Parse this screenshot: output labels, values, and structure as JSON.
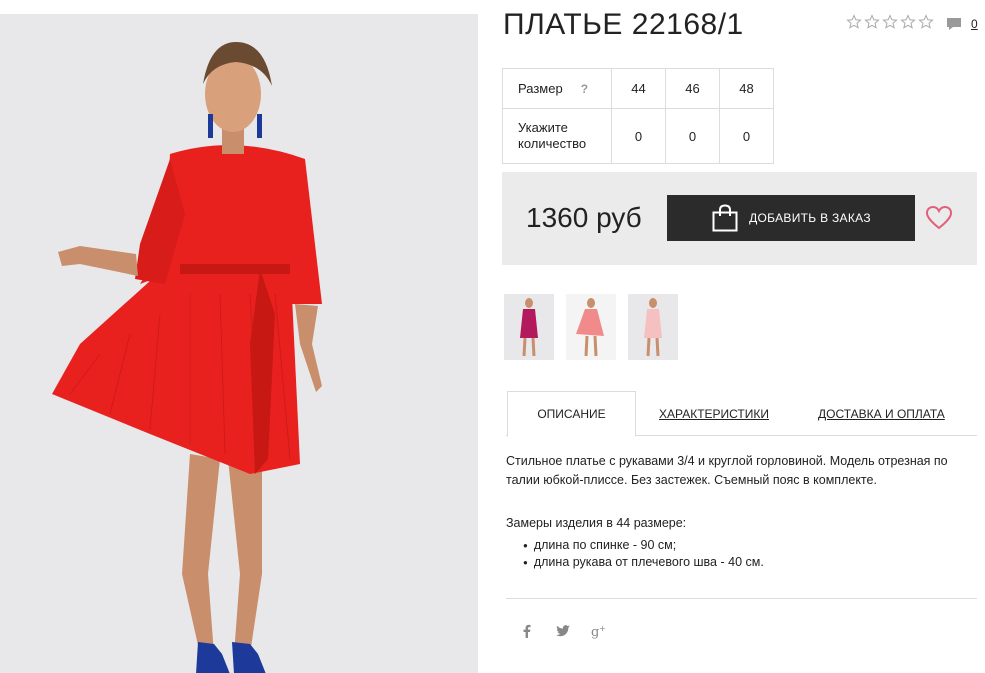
{
  "product": {
    "title": "ПЛАТЬЕ 22168/1",
    "rating_stars": 5,
    "rating_value": 0,
    "comments_count": "0"
  },
  "size_table": {
    "size_label": "Размер",
    "help_label": "?",
    "quantity_label": "Укажите количество",
    "sizes": [
      "44",
      "46",
      "48"
    ],
    "quantities": [
      "0",
      "0",
      "0"
    ]
  },
  "purchase": {
    "price": "1360 руб",
    "order_button": "ДОБАВИТЬ В ЗАКАЗ"
  },
  "tabs": {
    "description": "ОПИСАНИЕ",
    "characteristics": "ХАРАКТЕРИСТИКИ",
    "delivery": "ДОСТАВКА И ОПЛАТА"
  },
  "description": {
    "text": "Стильное платье с рукавами 3/4 и круглой горловиной. Модель отрезная по талии юбкой-плиссе. Без застежек. Съемный пояс в комплекте.",
    "measure_title": "Замеры изделия в 44 размере:",
    "measures": [
      "длина по спинке - 90 см;",
      "длина рукава от плечевого шва - 40 см."
    ]
  },
  "colors": {
    "dress": "#e8211f",
    "thumb1": "#b31a5e",
    "thumb2": "#f18a8a",
    "thumb3": "#f5c0c0",
    "heart": "#e0607a",
    "button": "#2b2b2b"
  }
}
